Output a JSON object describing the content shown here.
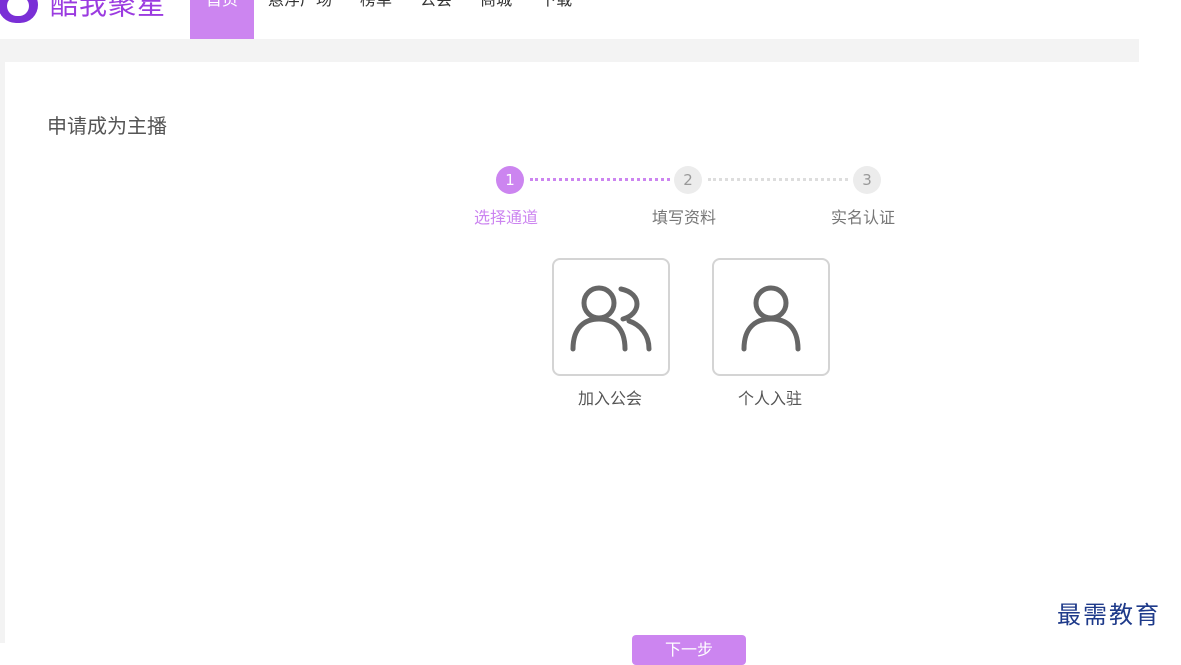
{
  "brand": {
    "name": "酷我聚星",
    "color": "#9b3be0"
  },
  "nav": {
    "items": [
      {
        "label": "首页",
        "active": true
      },
      {
        "label": "悬浮广场",
        "active": false
      },
      {
        "label": "榜单",
        "active": false
      },
      {
        "label": "公会",
        "active": false
      },
      {
        "label": "商城",
        "active": false
      },
      {
        "label": "下载",
        "active": false
      }
    ]
  },
  "page": {
    "title": "申请成为主播"
  },
  "stepper": {
    "steps": [
      {
        "number": "1",
        "label": "选择通道",
        "active": true
      },
      {
        "number": "2",
        "label": "填写资料",
        "active": false
      },
      {
        "number": "3",
        "label": "实名认证",
        "active": false
      }
    ]
  },
  "options": [
    {
      "label": "加入公会",
      "icon": "users-icon"
    },
    {
      "label": "个人入驻",
      "icon": "user-icon"
    }
  ],
  "actions": {
    "next_label": "下一步"
  },
  "watermark": {
    "text": "最需教育"
  },
  "theme": {
    "accent": "#cc85f0",
    "panel_bg": "#f3f3f3"
  }
}
